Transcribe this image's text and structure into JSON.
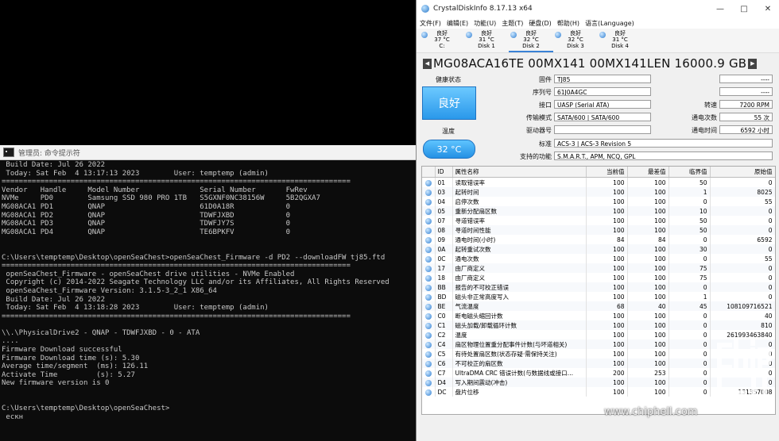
{
  "console": {
    "title": "管理员: 命令提示符",
    "lines": [
      " Build Date: Jul 26 2022",
      " Today: Sat Feb  4 13:17:13 2023        User: temptemp (admin)",
      "=================================================================================",
      "Vendor   Handle     Model Number              Serial Number       FwRev",
      "NVMe     PD0        Samsung SSD 980 PRO 1TB   S5GXNF0NC38156W     5B2QGXA7",
      "MG08ACA1 PD1        QNAP                      61D0A18R            0",
      "MG08ACA1 PD2        QNAP                      TDWFJXBD            0",
      "MG08ACA1 PD3        QNAP                      TDWFJY7S            0",
      "MG08ACA1 PD4        QNAP                      TE6BPKFV            0",
      "",
      "",
      "C:\\Users\\temptemp\\Desktop\\openSeaChest>openSeaChest_Firmware -d PD2 --downloadFW tj85.ftd",
      "=================================================================================",
      " openSeaChest_Firmware - openSeaChest drive utilities - NVMe Enabled",
      " Copyright (c) 2014-2022 Seagate Technology LLC and/or its Affiliates, All Rights Reserved",
      " openSeaChest_Firmware Version: 3.1.5-3_2_1 X86_64",
      " Build Date: Jul 26 2022",
      " Today: Sat Feb  4 13:18:28 2023        User: temptemp (admin)",
      "=================================================================================",
      "",
      "\\\\.\\PhysicalDrive2 - QNAP - TDWFJXBD - 0 - ATA",
      "....",
      "Firmware Download successful",
      "Firmware Download time (s): 5.30",
      "Average time/segment  (ms): 126.11",
      "Activate Time         (s): 5.27",
      "New firmware version is 0",
      "",
      "",
      "C:\\Users\\temptemp\\Desktop\\openSeaChest>",
      " ескн"
    ]
  },
  "cdi": {
    "title": "CrystalDiskInfo 8.17.13 x64",
    "menu": [
      "文件(F)",
      "编辑(E)",
      "功能(U)",
      "主题(T)",
      "硬盘(D)",
      "帮助(H)",
      "语言(Language)"
    ],
    "disks": [
      {
        "status": "良好",
        "temp": "37 °C",
        "name": "C:"
      },
      {
        "status": "良好",
        "temp": "31 °C",
        "name": "Disk 1"
      },
      {
        "status": "良好",
        "temp": "32 °C",
        "name": "Disk 2"
      },
      {
        "status": "良好",
        "temp": "32 °C",
        "name": "Disk 3"
      },
      {
        "status": "良好",
        "temp": "31 °C",
        "name": "Disk 4"
      }
    ],
    "selected_disk": 2,
    "model": "MG08ACA16TE     00MX141 00MX141LEN 16000.9 GB",
    "health_label": "健康状态",
    "health_value": "良好",
    "temp_label": "温度",
    "temp_value": "32 °C",
    "firmware_label": "固件",
    "firmware": "TJ85",
    "serial_label": "序列号",
    "serial": "61J0A4GC",
    "interface_label": "接口",
    "interface": "UASP (Serial ATA)",
    "transfer_label": "传输模式",
    "transfer": "SATA/600 | SATA/600",
    "drive_letter_label": "驱动器号",
    "drive_letter": "",
    "standard_label": "标准",
    "standard": "ACS-3 | ACS-3 Revision 5",
    "features_label": "支持的功能",
    "features": "S.M.A.R.T., APM, NCQ, GPL",
    "right1": "----",
    "right2": "----",
    "rotation_label": "转速",
    "rotation": "7200 RPM",
    "power_count_label": "通电次数",
    "power_count": "55 次",
    "power_hours_label": "通电时间",
    "power_hours": "6592 小时",
    "table_headers": [
      "",
      "ID",
      "属性名称",
      "当前值",
      "最差值",
      "临界值",
      "原始值"
    ],
    "smart_rows": [
      [
        "01",
        "读取错误率",
        "100",
        "100",
        "50",
        "0"
      ],
      [
        "03",
        "起转时间",
        "100",
        "100",
        "1",
        "8025"
      ],
      [
        "04",
        "启停次数",
        "100",
        "100",
        "0",
        "55"
      ],
      [
        "05",
        "重新分配扇区数",
        "100",
        "100",
        "10",
        "0"
      ],
      [
        "07",
        "寻道错误率",
        "100",
        "100",
        "50",
        "0"
      ],
      [
        "08",
        "寻道时间性能",
        "100",
        "100",
        "50",
        "0"
      ],
      [
        "09",
        "通电时间(小时)",
        "84",
        "84",
        "0",
        "6592"
      ],
      [
        "0A",
        "起转重试次数",
        "100",
        "100",
        "30",
        "0"
      ],
      [
        "0C",
        "通电次数",
        "100",
        "100",
        "0",
        "55"
      ],
      [
        "17",
        "由厂商定义",
        "100",
        "100",
        "75",
        "0"
      ],
      [
        "18",
        "由厂商定义",
        "100",
        "100",
        "75",
        "0"
      ],
      [
        "BB",
        "报告的不可校正错误",
        "100",
        "100",
        "0",
        "0"
      ],
      [
        "BD",
        "磁头非正常高度写入",
        "100",
        "100",
        "1",
        "0"
      ],
      [
        "BE",
        "气流温度",
        "68",
        "40",
        "45",
        "108109716521"
      ],
      [
        "C0",
        "断电磁头缩回计数",
        "100",
        "100",
        "0",
        "40"
      ],
      [
        "C1",
        "磁头加载/卸载循环计数",
        "100",
        "100",
        "0",
        "810"
      ],
      [
        "C2",
        "温度",
        "100",
        "100",
        "0",
        "261993463840"
      ],
      [
        "C4",
        "扇区物理位置重分配事件计数(与坏道相关)",
        "100",
        "100",
        "0",
        "0"
      ],
      [
        "C5",
        "有待处置扇区数(状态存疑·需保持关注)",
        "100",
        "100",
        "0",
        "0"
      ],
      [
        "C6",
        "不可校正的扇区数",
        "100",
        "100",
        "0",
        "0"
      ],
      [
        "C7",
        "UltraDMA CRC 错误计数(与数据线或接口…",
        "200",
        "253",
        "0",
        "0"
      ],
      [
        "D4",
        "写入期间震动(冲击)",
        "100",
        "100",
        "0",
        "0"
      ],
      [
        "DC",
        "盘片位移",
        "100",
        "100",
        "0",
        "131357008"
      ]
    ]
  },
  "watermark": {
    "url": "www.chiphell.com",
    "logo": "chip hell"
  }
}
